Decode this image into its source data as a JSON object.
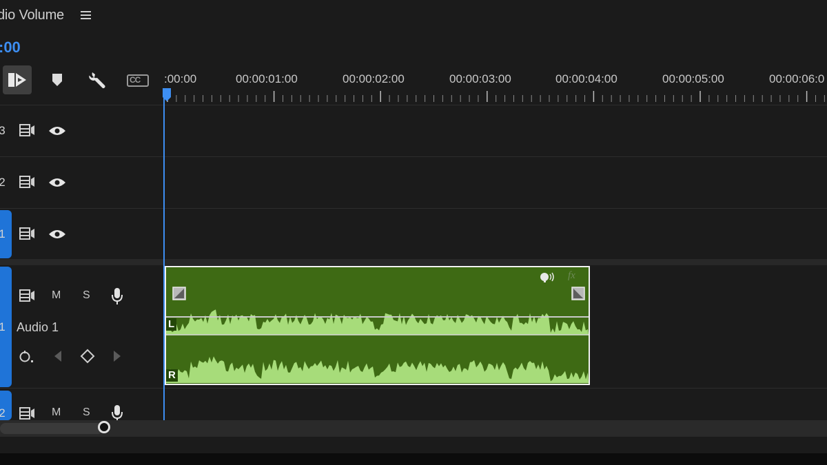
{
  "panel": {
    "title": "dio Volume",
    "timecode": ":00"
  },
  "toolbar": {
    "icons": [
      "snap-icon",
      "marker-icon",
      "wrench-icon",
      "captions-icon"
    ],
    "captions_label": "CC"
  },
  "ruler": {
    "labels": [
      ":00:00",
      "00:00:01:00",
      "00:00:02:00",
      "00:00:03:00",
      "00:00:04:00",
      "00:00:05:00",
      "00:00:06:0"
    ]
  },
  "video_tracks": [
    {
      "number": "3",
      "icons": [
        "film-icon",
        "eye-icon"
      ]
    },
    {
      "number": "2",
      "icons": [
        "film-icon",
        "eye-icon"
      ]
    },
    {
      "number": "1",
      "icons": [
        "film-icon",
        "eye-icon"
      ],
      "targeted": true
    }
  ],
  "audio_tracks": [
    {
      "number": "1",
      "name": "Audio 1",
      "mute": "M",
      "solo": "S",
      "targeted": true
    },
    {
      "number": "2",
      "mute": "M",
      "solo": "S",
      "targeted": true
    }
  ],
  "clip": {
    "channel_left": "L",
    "channel_right": "R",
    "fx_label": "fx",
    "color": "#3e6a14",
    "waveform_color": "#a7dc7a"
  },
  "colors": {
    "accent": "#3d8ef2",
    "track_target": "#1f74d8"
  }
}
